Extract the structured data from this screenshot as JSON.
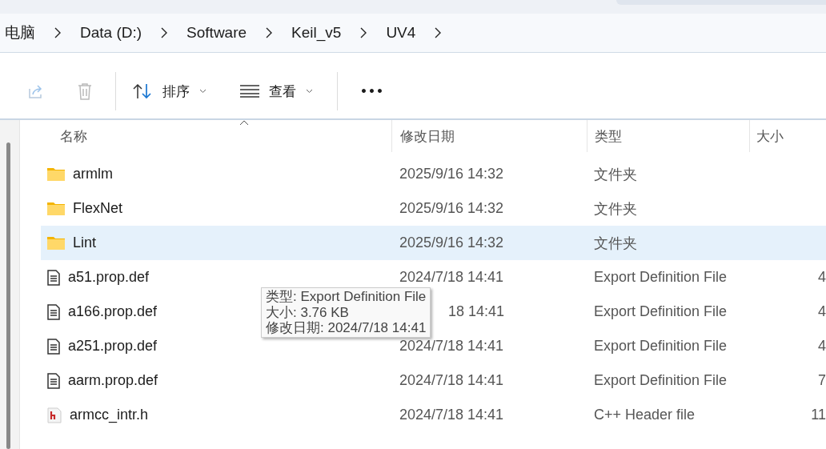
{
  "breadcrumb": [
    "电脑",
    "Data (D:)",
    "Software",
    "Keil_v5",
    "UV4"
  ],
  "toolbar": {
    "sort": "排序",
    "view": "查看",
    "more": "•••"
  },
  "table": {
    "columns": [
      "名称",
      "修改日期",
      "类型",
      "大小"
    ],
    "rows": [
      {
        "kind": "folder",
        "name": "armlm",
        "date": "2025/9/16 14:32",
        "type": "文件夹",
        "size": "",
        "selected": false
      },
      {
        "kind": "folder",
        "name": "FlexNet",
        "date": "2025/9/16 14:32",
        "type": "文件夹",
        "size": "",
        "selected": false
      },
      {
        "kind": "folder",
        "name": "Lint",
        "date": "2025/9/16 14:32",
        "type": "文件夹",
        "size": "",
        "selected": true
      },
      {
        "kind": "text",
        "name": "a51.prop.def",
        "date": "2024/7/18 14:41",
        "type": "Export Definition File",
        "size": "4",
        "selected": false
      },
      {
        "kind": "text",
        "name": "a166.prop.def",
        "date": "18 14:41",
        "date_cut": true,
        "type": "Export Definition File",
        "size": "4",
        "selected": false
      },
      {
        "kind": "text",
        "name": "a251.prop.def",
        "date": "2024/7/18 14:41",
        "type": "Export Definition File",
        "size": "4",
        "selected": false
      },
      {
        "kind": "text",
        "name": "aarm.prop.def",
        "date": "2024/7/18 14:41",
        "type": "Export Definition File",
        "size": "7",
        "selected": false
      },
      {
        "kind": "header",
        "name": "armcc_intr.h",
        "date": "2024/7/18 14:41",
        "type": "C++ Header file",
        "size": "11",
        "selected": false
      }
    ]
  },
  "tooltip": [
    "类型: Export Definition File",
    "大小: 3.76 KB",
    "修改日期: 2024/7/18 14:41"
  ]
}
